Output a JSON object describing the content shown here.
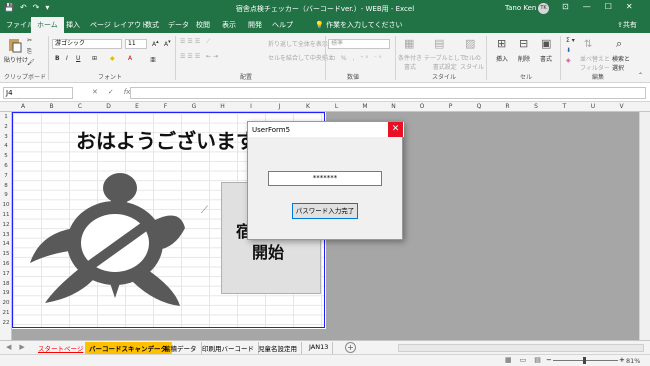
{
  "window": {
    "title": "宿舎点検チェッカー（バーコードver.）- WEB用 - Excel",
    "user": "Tano Ken",
    "avatar_initials": "TK",
    "quick_access": [
      "💾",
      "↶",
      "↷",
      "▾"
    ],
    "controls": [
      "⊡",
      "—",
      "☐",
      "✕"
    ]
  },
  "ribbon_tabs": [
    "ファイル",
    "ホーム",
    "挿入",
    "ページ レイアウト",
    "数式",
    "データ",
    "校閲",
    "表示",
    "開発",
    "ヘルプ"
  ],
  "active_tab": "ホーム",
  "tell_me": "作業を入力してください",
  "share": "共有",
  "ribbon": {
    "paste": "貼り付け",
    "clipboard_label": "クリップボード",
    "font_name": "游ゴシック",
    "font_size": "11",
    "font_label": "フォント",
    "wrap_text": "折り返して全体を表示する",
    "merge_center": "セルを結合して中央揃え",
    "alignment_label": "配置",
    "number_format": "標準",
    "number_label": "数値",
    "cond_format": "条件付き\n書式",
    "format_table": "テーブルとして\n書式設定",
    "cell_styles": "セルの\nスタイル",
    "styles_label": "スタイル",
    "insert": "挿入",
    "delete": "削除",
    "format": "書式",
    "cells_label": "セル",
    "sort_filter": "並べ替えと\nフィルター",
    "find_select": "検索と\n選択",
    "editing_label": "編集"
  },
  "formula_bar": {
    "name_box": "J4",
    "buttons": [
      "✕",
      "✓",
      "fx"
    ],
    "formula": ""
  },
  "columns": [
    "A",
    "B",
    "C",
    "D",
    "E",
    "F",
    "G",
    "H",
    "I",
    "J",
    "K",
    "L",
    "M",
    "N",
    "O",
    "P",
    "Q",
    "R",
    "S",
    "T",
    "U",
    "V"
  ],
  "rows": [
    "1",
    "2",
    "3",
    "4",
    "5",
    "6",
    "7",
    "8",
    "9",
    "10",
    "11",
    "12",
    "13",
    "14",
    "15",
    "16",
    "17",
    "18",
    "19",
    "20",
    "21",
    "22"
  ],
  "sheet": {
    "greeting": "おはようございます",
    "start_line1": "宿",
    "start_line2": "開始"
  },
  "dialog": {
    "title": "UserForm5",
    "close": "✕",
    "password_value": "*******",
    "button": "パスワード入力完了"
  },
  "sheet_tabs": [
    "スタートページ",
    "バーコードスキャンデータ",
    "蓄積データ",
    "印刷用バーコード",
    "児童名設定用",
    "JAN13"
  ],
  "active_sheet": "バーコードスキャンデータ",
  "status": {
    "zoom": "81%"
  },
  "colors": {
    "excel_green": "#217346",
    "close_red": "#e81123",
    "active_sheet_tab": "#ffc000",
    "start_tab_text": "#ff0000",
    "sheet_border": "#2020ff",
    "turtle": "#595959"
  }
}
